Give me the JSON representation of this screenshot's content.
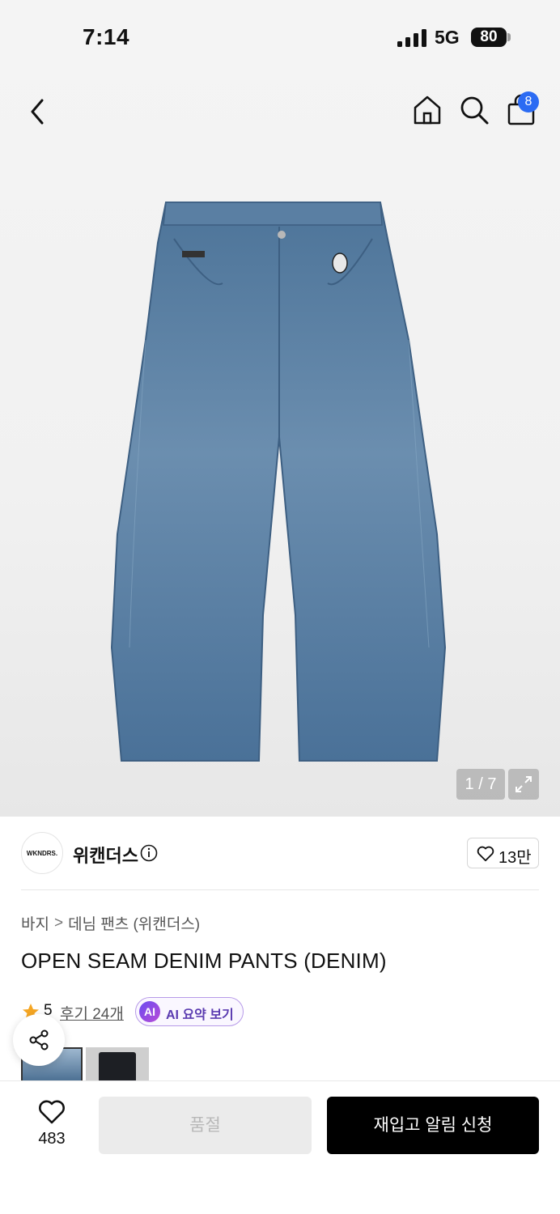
{
  "status_bar": {
    "time": "7:14",
    "network": "5G",
    "battery": "80"
  },
  "header": {
    "cart_badge": "8"
  },
  "gallery": {
    "pager": "1 / 7"
  },
  "brand": {
    "logo_text": "WKNDRS.",
    "name": "위캔더스",
    "likes": "13만"
  },
  "breadcrumb": {
    "level1": "바지",
    "separator": ">",
    "level2": "데님 팬츠 (위캔더스)"
  },
  "product": {
    "title": "OPEN SEAM DENIM PANTS (DENIM)"
  },
  "rating": {
    "score": "5",
    "review_link": "후기 24개",
    "ai_badge": "AI",
    "ai_label": "AI 요약 보기"
  },
  "bottom_bar": {
    "wish_count": "483",
    "soldout_label": "품절",
    "restock_label": "재입고 알림 신청"
  },
  "colors": {
    "accent_badge": "#2b6bf3",
    "star": "#f5a623",
    "ai_border": "#b79ae8",
    "primary_button": "#000000"
  }
}
